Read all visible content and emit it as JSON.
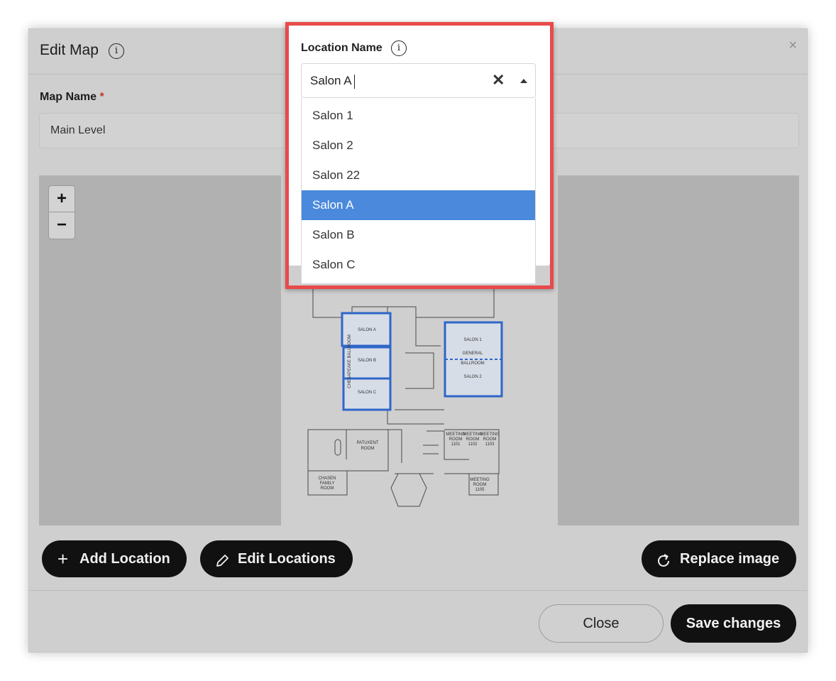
{
  "modal": {
    "title": "Edit Map",
    "close_symbol": "×",
    "info_icon": "info-icon"
  },
  "map_name": {
    "label": "Map Name",
    "required_mark": "*",
    "value": "Main Level"
  },
  "zoom": {
    "in": "+",
    "out": "−"
  },
  "floor_plan": {
    "rooms": [
      "SALON A",
      "SALON B",
      "SALON C",
      "SALON 1",
      "GENERAL",
      "BALLROOM",
      "SALON 2",
      "PATUXENT ROOM",
      "CHASEN FAMILY ROOM",
      "MEETING ROOM 1101",
      "MEETING ROOM 1102",
      "MEETING ROOM 1103",
      "MEETING ROOM 1105"
    ],
    "highlight_color": "#2f66c9"
  },
  "actions": {
    "add_location": "Add Location",
    "edit_locations": "Edit Locations",
    "replace_image": "Replace image"
  },
  "footer": {
    "close": "Close",
    "save": "Save changes"
  },
  "location_picker": {
    "label": "Location Name",
    "value": "Salon A",
    "clear_symbol": "✕",
    "options": [
      "Salon 1",
      "Salon 2",
      "Salon 22",
      "Salon A",
      "Salon B",
      "Salon C"
    ],
    "selected_index": 3,
    "selected_color": "#4a89dc",
    "frame_color": "#e84a4a"
  }
}
